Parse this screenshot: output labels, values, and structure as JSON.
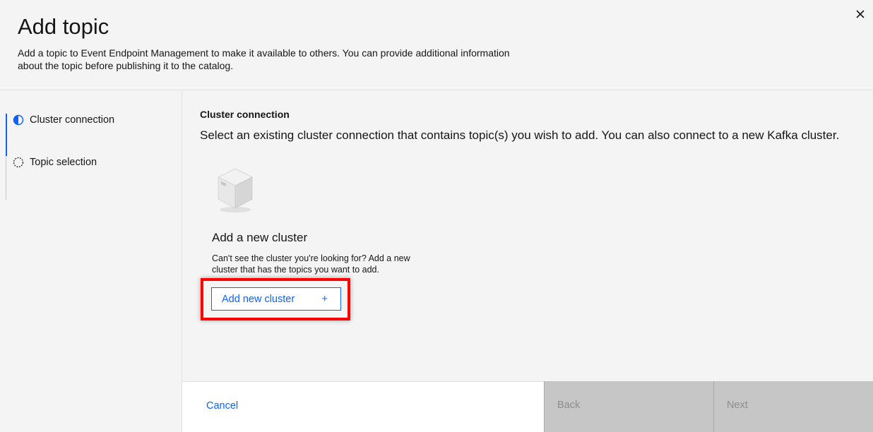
{
  "header": {
    "title": "Add topic",
    "subtitle": "Add a topic to Event Endpoint Management to make it available to others. You can provide additional information about the topic before publishing it to the catalog.",
    "close_icon": "close-icon"
  },
  "stepper": {
    "steps": [
      {
        "label": "Cluster connection",
        "state": "current",
        "icon": "half-filled-circle-icon"
      },
      {
        "label": "Topic selection",
        "state": "incomplete",
        "icon": "dashed-circle-icon"
      }
    ]
  },
  "main": {
    "section_title": "Cluster connection",
    "section_description": "Select an existing cluster connection that contains topic(s) you wish to add. You can also connect to a new Kafka cluster.",
    "card": {
      "icon": "cube-icon",
      "title": "Add a new cluster",
      "description": "Can't see the cluster you're looking for? Add a new cluster that has the topics you want to add.",
      "button_label": "Add new cluster",
      "button_icon": "+"
    }
  },
  "footer": {
    "cancel_label": "Cancel",
    "back_label": "Back",
    "next_label": "Next"
  },
  "colors": {
    "accent": "#0f62fe",
    "highlight": "#ff0000",
    "disabled_bg": "#c6c6c6",
    "disabled_text": "#8d8d8d"
  }
}
